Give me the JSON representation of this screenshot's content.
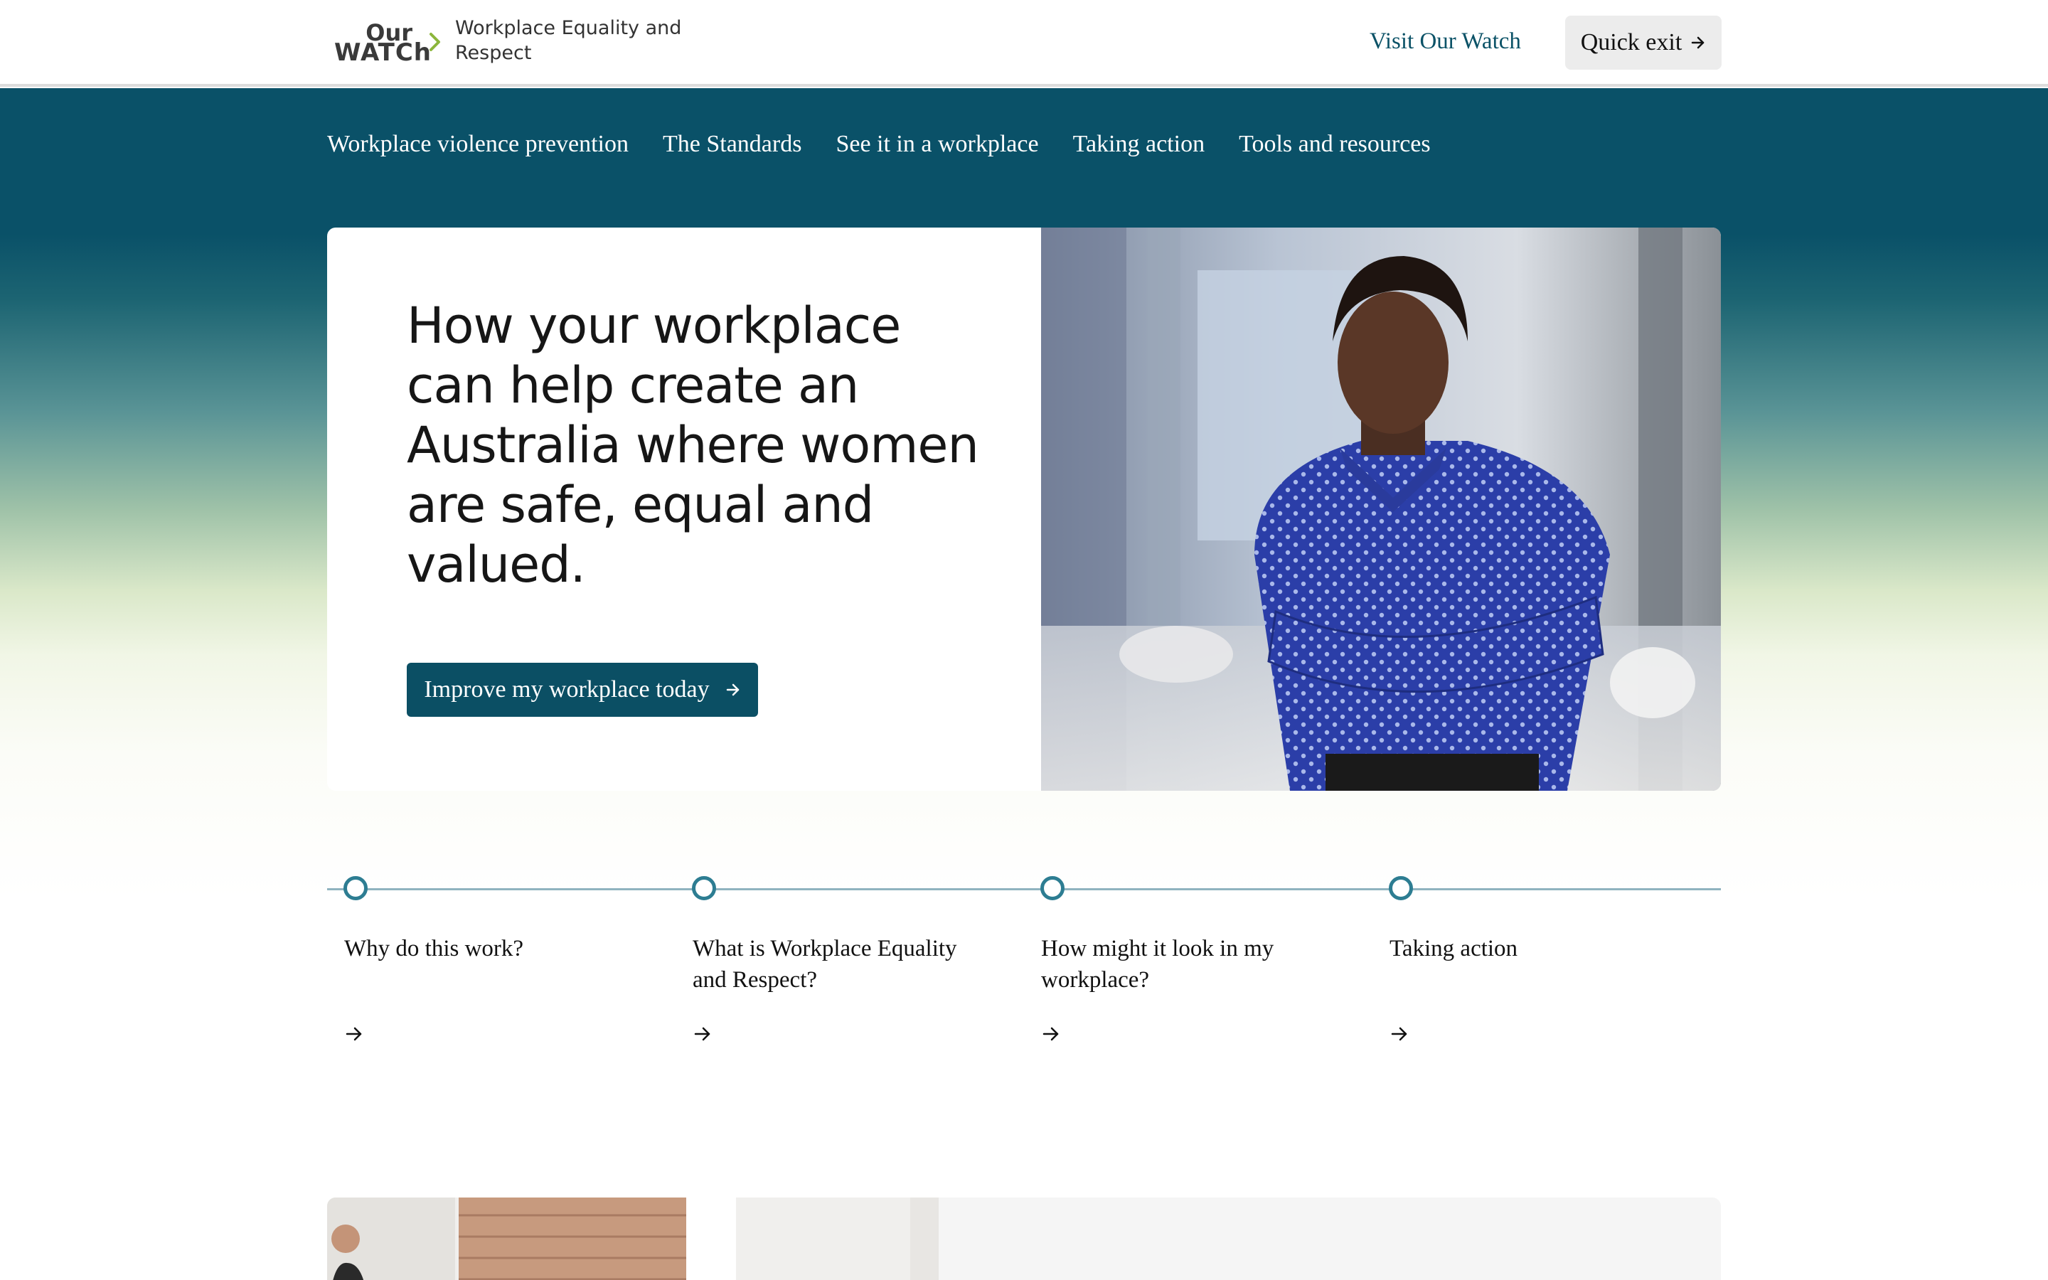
{
  "header": {
    "logo_line1": "Our",
    "logo_line2": "WATCh",
    "site_title": "Workplace Equality and Respect",
    "visit_link": "Visit Our Watch",
    "quick_exit": "Quick exit"
  },
  "nav": {
    "items": [
      "Workplace violence prevention",
      "The Standards",
      "See it in a workplace",
      "Taking action",
      "Tools and resources"
    ]
  },
  "hero": {
    "heading": "How your workplace can help create an Australia where women are safe, equal and valued.",
    "cta_label": "Improve my workplace today"
  },
  "steps": [
    {
      "label": "Why do this work?"
    },
    {
      "label": "What is Workplace Equality and Respect?"
    },
    {
      "label": "How might it look in my workplace?"
    },
    {
      "label": "Taking action"
    }
  ],
  "colors": {
    "brand_teal": "#0b4f64",
    "accent_green": "#8cb63c",
    "step_dot": "#2d7d92"
  },
  "icons": {
    "breadcrumb": "chevron-right-icon",
    "arrow": "arrow-right-icon"
  }
}
